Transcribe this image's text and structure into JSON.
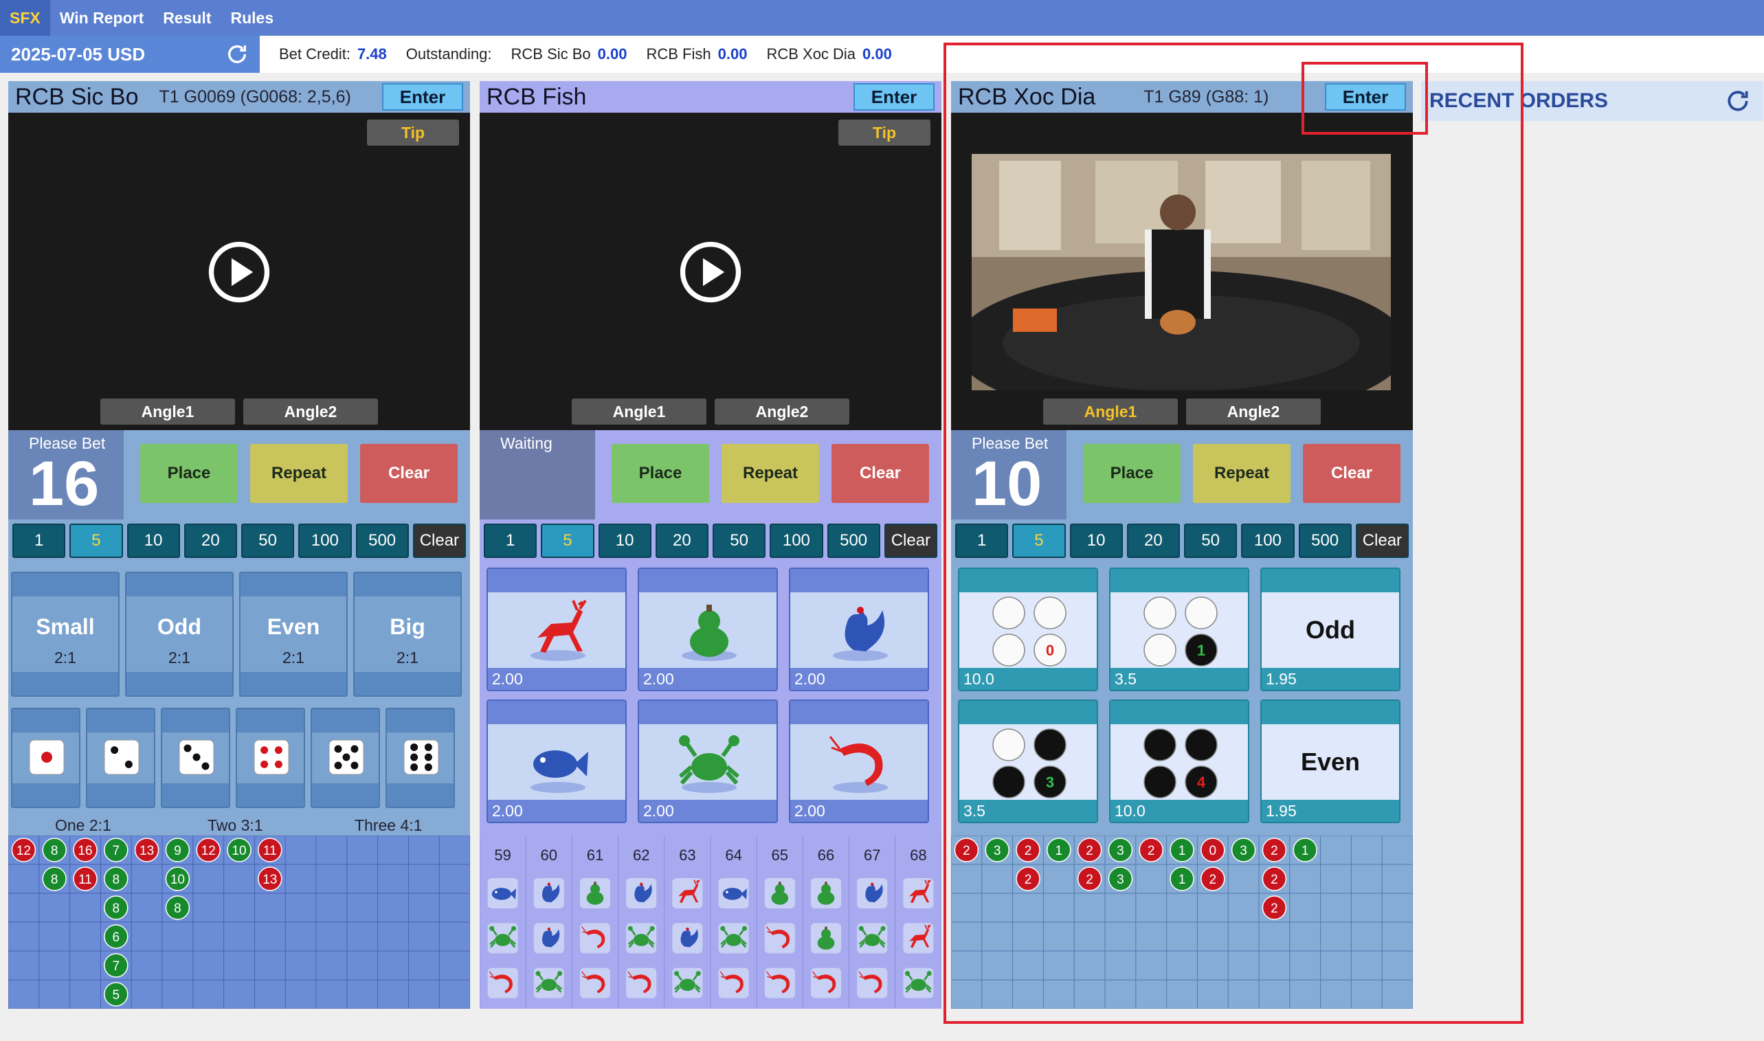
{
  "nav": {
    "items": [
      "SFX",
      "Win Report",
      "Result",
      "Rules"
    ]
  },
  "info": {
    "date": "2025-07-05 USD",
    "bet_credit_label": "Bet Credit:",
    "bet_credit": "7.48",
    "outstanding_label": "Outstanding:",
    "rcb_sicbo_label": "RCB Sic Bo",
    "rcb_sicbo_value": "0.00",
    "rcb_fish_label": "RCB Fish",
    "rcb_fish_value": "0.00",
    "rcb_xocdia_label": "RCB Xoc Dia",
    "rcb_xocdia_value": "0.00"
  },
  "recent": {
    "title": "RECENT ORDERS"
  },
  "common": {
    "enter": "Enter",
    "tip": "Tip",
    "angle1": "Angle1",
    "angle2": "Angle2",
    "place": "Place",
    "repeat": "Repeat",
    "clear": "Clear",
    "chips": [
      "1",
      "5",
      "10",
      "20",
      "50",
      "100",
      "500"
    ],
    "chip_clear": "Clear",
    "selected_chip": "5"
  },
  "sicbo": {
    "name": "RCB Sic Bo",
    "round": "T1 G0069 (G0068: 2,5,6)",
    "status": "Please Bet",
    "countdown": "16",
    "bigbets": [
      {
        "name": "Small",
        "odds": "2:1"
      },
      {
        "name": "Odd",
        "odds": "2:1"
      },
      {
        "name": "Even",
        "odds": "2:1"
      },
      {
        "name": "Big",
        "odds": "2:1"
      }
    ],
    "dice": [
      1,
      2,
      3,
      4,
      5,
      6
    ],
    "groups": [
      "One 2:1",
      "Two 3:1",
      "Three 4:1"
    ],
    "history": [
      [
        "12",
        "8",
        "16",
        "7",
        "13",
        "9",
        "12",
        "10",
        "11"
      ],
      [
        "",
        "8",
        "11",
        "8",
        "",
        "10",
        "",
        "",
        "13"
      ],
      [
        "",
        "",
        "",
        "8",
        "",
        "8",
        "",
        "",
        ""
      ],
      [
        "",
        "",
        "",
        "6",
        "",
        "",
        "",
        "",
        ""
      ],
      [
        "",
        "",
        "",
        "7",
        "",
        "",
        "",
        "",
        ""
      ],
      [
        "",
        "",
        "",
        "5",
        "",
        "",
        "",
        "",
        ""
      ]
    ],
    "history_colors": {
      "red": [
        "12",
        "16",
        "13",
        "11"
      ],
      "green": [
        "8",
        "7",
        "9",
        "10",
        "6",
        "5"
      ]
    }
  },
  "fish": {
    "name": "RCB Fish",
    "status": "Waiting",
    "bets": [
      {
        "animal": "deer",
        "odds": "2.00"
      },
      {
        "animal": "gourd",
        "odds": "2.00"
      },
      {
        "animal": "rooster",
        "odds": "2.00"
      },
      {
        "animal": "fish",
        "odds": "2.00"
      },
      {
        "animal": "crab",
        "odds": "2.00"
      },
      {
        "animal": "shrimp",
        "odds": "2.00"
      }
    ],
    "rounds": [
      "59",
      "60",
      "61",
      "62",
      "63",
      "64",
      "65",
      "66",
      "67",
      "68"
    ],
    "results": [
      [
        "fish",
        "rooster",
        "gourd",
        "rooster",
        "deer",
        "fish",
        "gourd",
        "gourd",
        "rooster",
        "deer"
      ],
      [
        "crab",
        "rooster",
        "shrimp",
        "crab",
        "rooster",
        "crab",
        "shrimp",
        "gourd",
        "crab",
        "deer"
      ],
      [
        "shrimp",
        "crab",
        "shrimp",
        "shrimp",
        "crab",
        "shrimp",
        "shrimp",
        "shrimp",
        "shrimp",
        "crab"
      ]
    ]
  },
  "xocdia": {
    "name": "RCB Xoc Dia",
    "round": "T1 G89  (G88: 1)",
    "status": "Please Bet",
    "countdown": "10",
    "bets": [
      {
        "count": "0",
        "odds": "10.0",
        "reds": 0
      },
      {
        "count": "1",
        "odds": "3.5",
        "reds": 1
      },
      {
        "name": "Odd",
        "odds": "1.95"
      },
      {
        "count": "3",
        "odds": "3.5",
        "reds": 3
      },
      {
        "count": "4",
        "odds": "10.0",
        "reds": 4
      },
      {
        "name": "Even",
        "odds": "1.95"
      }
    ],
    "history": [
      [
        "2",
        "3",
        "2",
        "1",
        "2",
        "3",
        "2",
        "1",
        "0",
        "3",
        "2",
        "1"
      ],
      [
        "",
        "",
        "2",
        "",
        "2",
        "3",
        "",
        "1",
        "2",
        "",
        "2",
        ""
      ],
      [
        "",
        "",
        "",
        "",
        "",
        "",
        "",
        "",
        "",
        "",
        "2",
        ""
      ]
    ]
  },
  "colors": {
    "accent": "#5a7fd0",
    "red_box": "#e0212e",
    "red_ball": "#c8141e",
    "green_ball": "#178a2b",
    "fish_blue": "#2f54b8",
    "fish_red": "#e02020",
    "fish_green": "#2e9a3a"
  }
}
